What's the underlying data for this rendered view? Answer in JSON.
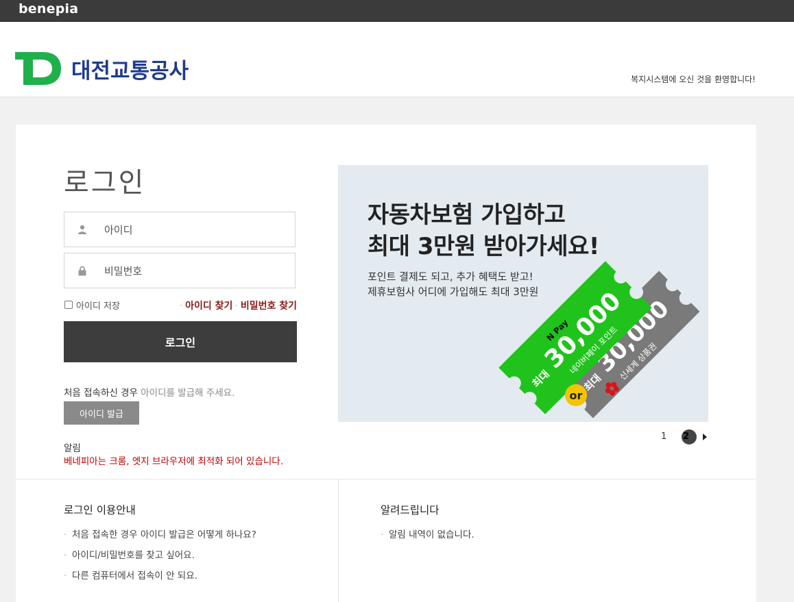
{
  "topbar": {
    "brand": "benepia"
  },
  "header": {
    "logo_mark": "TD",
    "corp_name": "대전교통공사",
    "welcome": "복지시스템에 오신 것을 환영합니다!"
  },
  "login": {
    "title": "로그인",
    "id_placeholder": "아이디",
    "pw_placeholder": "비밀번호",
    "save_id_label": "아이디 저장",
    "find_id_link": "아이디 찾기",
    "find_pw_link": "비밀번호 찾기",
    "login_button": "로그인",
    "first_access_text": "처음 접속하신 경우",
    "first_access_hint": "아이디를 발급해 주세요.",
    "issue_button": "아이디 발급",
    "notice_label": "알림",
    "notice_text": "베네피아는 크롬, 엣지 브라우저에 최적화 되어 있습니다."
  },
  "banner": {
    "headline_line1": "자동차보험 가입하고",
    "headline_line2": "최대 3만원 받아가세요!",
    "sub_line1": "포인트 결제도 되고, 추가 혜택도 받고!",
    "sub_line2": "제휴보험사 어디에 가입해도 최대 3만원",
    "ticket_green": {
      "brand": "N Pay",
      "prefix": "최대",
      "amount": "30,000",
      "label": "네이버페이 포인트"
    },
    "ticket_gray": {
      "prefix": "최대",
      "amount": "30,000",
      "label": "신세계 상품권"
    },
    "or_label": "or",
    "colors": {
      "green": "#1fc31b",
      "gray": "#7a7a7a",
      "or_badge": "#f5c400",
      "bg": "#e3ebf1"
    }
  },
  "pager": {
    "page1": "1",
    "page2": "2",
    "current": 2
  },
  "guide": {
    "title": "로그인 이용안내",
    "items": [
      "처음 접속한 경우 아이디 발급은 어떻게 하나요?",
      "아이디/비밀번호를 찾고 싶어요.",
      "다른 컴퓨터에서 접속이 안 되요."
    ]
  },
  "news": {
    "title": "알려드립니다",
    "items": [
      "알림 내역이 없습니다."
    ]
  },
  "icons": {
    "id_field": "user-icon",
    "pw_field": "lock-icon",
    "pager_next": "triangle-right-icon"
  }
}
